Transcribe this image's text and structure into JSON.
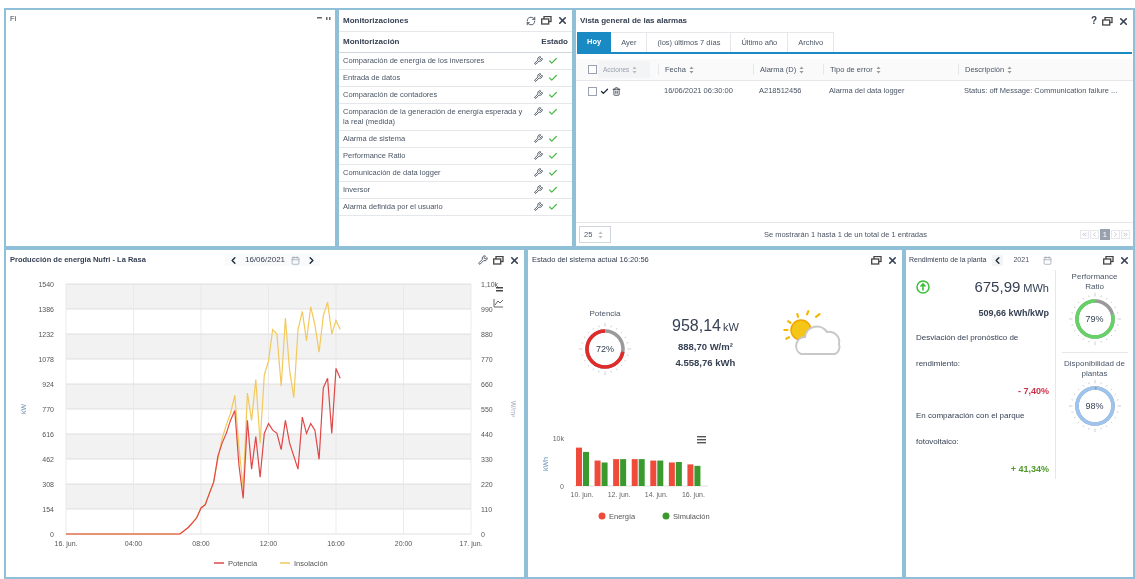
{
  "top_left_panel": {
    "title": "Fi"
  },
  "monitoring": {
    "title": "Monitorizaciones",
    "columns": [
      "Monitorización",
      "Estado"
    ],
    "rows": [
      {
        "name": "Comparación de energía de los inversores",
        "ok": true
      },
      {
        "name": "Entrada de datos",
        "ok": true
      },
      {
        "name": "Comparación de contadores",
        "ok": true
      },
      {
        "name": "Comparación de la generación de energía esperada y la real (medida)",
        "ok": true
      },
      {
        "name": "Alarma de sistema",
        "ok": true
      },
      {
        "name": "Performance Ratio",
        "ok": true
      },
      {
        "name": "Comunicación de data logger",
        "ok": true
      },
      {
        "name": "Inversor",
        "ok": true
      },
      {
        "name": "Alarma definida por el usuario",
        "ok": true
      }
    ]
  },
  "alarms": {
    "title": "Vista general de las alarmas",
    "help": "?",
    "tabs": [
      {
        "label": "Hoy",
        "selected": true
      },
      {
        "label": "Ayer",
        "selected": false
      },
      {
        "label": "(los) últimos 7 días",
        "selected": false
      },
      {
        "label": "Último año",
        "selected": false
      },
      {
        "label": "Archivo",
        "selected": false
      }
    ],
    "select_all_checked": false,
    "columns": [
      "Acciones",
      "Fecha",
      "Alarma (D)",
      "Tipo de error",
      "Descripción"
    ],
    "rows": [
      {
        "checked": false,
        "date": "16/06/2021 06:30:00",
        "alarm": "A218512456",
        "type": "Alarma del data logger",
        "description": "Status: off Message: Communication failure ..."
      }
    ],
    "page_size": "25",
    "summary": "Se mostrarán 1 hasta 1 de un total de 1 entradas",
    "pages": [
      {
        "label": "1",
        "selected": true
      }
    ]
  },
  "production": {
    "title": "Producción de energía Nufri - La Rasa",
    "date": "16/06/2021",
    "right_axis": {
      "label": "W/m²",
      "ticks": [
        "1,10k",
        "990",
        "880",
        "770",
        "660",
        "550",
        "440",
        "330",
        "220",
        "110",
        "0"
      ]
    },
    "chart_data": {
      "type": "line",
      "ylabel": "kW",
      "x": [
        0,
        6.75,
        7,
        7.25,
        7.5,
        7.75,
        8,
        8.25,
        8.5,
        8.75,
        9,
        9.25,
        9.5,
        9.75,
        10,
        10.25,
        10.5,
        10.75,
        11,
        11.25,
        11.5,
        11.75,
        12,
        12.25,
        12.5,
        12.75,
        13,
        13.25,
        13.5,
        13.75,
        14,
        14.25,
        14.5,
        14.75,
        15,
        15.25,
        15.5,
        15.75,
        16,
        16.25
      ],
      "series": [
        {
          "name": "Potencia",
          "color": "#e04848",
          "values": [
            0,
            0,
            20,
            40,
            70,
            100,
            160,
            180,
            250,
            320,
            480,
            560,
            620,
            700,
            760,
            420,
            220,
            700,
            400,
            600,
            350,
            620,
            680,
            640,
            620,
            520,
            700,
            560,
            480,
            400,
            720,
            620,
            680,
            640,
            460,
            900,
            960,
            620,
            1020,
            960
          ]
        },
        {
          "name": "Insolación",
          "color": "#f2c95c",
          "values": [
            0,
            0,
            21,
            42,
            70,
            105,
            161,
            182,
            252,
            322,
            462,
            588,
            672,
            742,
            854,
            532,
            280,
            868,
            700,
            952,
            560,
            980,
            1064,
            1260,
            1232,
            910,
            1330,
            1008,
            840,
            1260,
            1372,
            1190,
            1400,
            1288,
            1120,
            1344,
            1428,
            1232,
            1316,
            1260
          ]
        }
      ],
      "xlim": [
        0,
        24
      ],
      "ylim": [
        0,
        1540
      ],
      "yticks": [
        0,
        154,
        308,
        462,
        616,
        770,
        924,
        1078,
        1232,
        1386,
        1540
      ],
      "xticks": [
        {
          "value": 0,
          "label": "16. jun."
        },
        {
          "value": 4,
          "label": "04:00"
        },
        {
          "value": 8,
          "label": "08:00"
        },
        {
          "value": 12,
          "label": "12:00"
        },
        {
          "value": 16,
          "label": "16:00"
        },
        {
          "value": 20,
          "label": "20:00"
        },
        {
          "value": 24,
          "label": "17. jun."
        }
      ],
      "grid": true,
      "legend": "bottom"
    }
  },
  "status": {
    "title": "Estado del sistema actual 16:20:56",
    "gauge": {
      "label": "Potencia",
      "reading": "72%"
    },
    "power": {
      "value": "958,14",
      "unit": "kW"
    },
    "irradiance": "888,70 W/m²",
    "energy": "4.558,76 kWh",
    "chart_data": {
      "type": "bar",
      "ylabel": "kWh",
      "categories": [
        "10. jun.",
        null,
        "12. jun.",
        null,
        "14. jun.",
        null,
        "16. jun."
      ],
      "series": [
        {
          "name": "Energía",
          "color": "#ee4b3b",
          "values": [
            8000,
            5300,
            5600,
            5600,
            5300,
            4900,
            4500
          ]
        },
        {
          "name": "Simulación",
          "color": "#3a9a2e",
          "values": [
            7100,
            4900,
            5600,
            5600,
            5300,
            5000,
            4200
          ]
        }
      ],
      "ylim": [
        0,
        10000
      ],
      "yticks": [
        0,
        {
          "value": 10000,
          "label": "10k"
        }
      ],
      "legend": "bottom"
    }
  },
  "plant": {
    "title": "Rendimiento de la planta",
    "year": "2021",
    "energy": {
      "value": "675,99",
      "unit": "MWh"
    },
    "specific": "509,66 kWh/kWp",
    "deviation_label": "Desviación del pronóstico de rendimiento:",
    "deviation": "- 7,40%",
    "comparison_label": "En comparación con el parque fotovoltaico:",
    "comparison": "+ 41,34%",
    "gauges": [
      {
        "label": "Performance Ratio",
        "reading": "79%",
        "color": "#66d166"
      },
      {
        "label": "Disponibilidad de plantas",
        "reading": "98%",
        "color": "#9cc4ef"
      }
    ]
  }
}
